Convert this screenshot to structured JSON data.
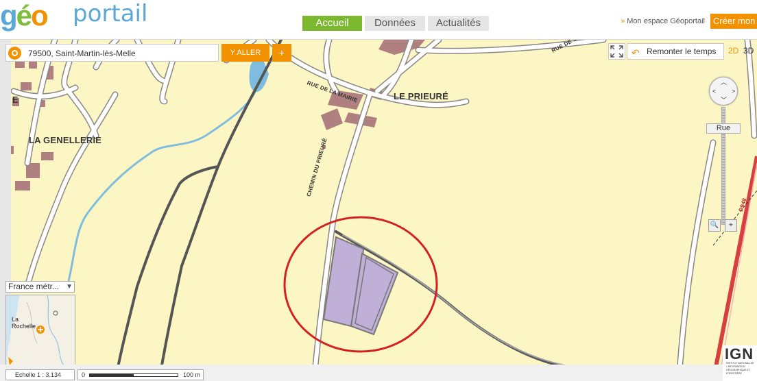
{
  "header": {
    "logo": {
      "geo": "géo",
      "portail": "portail"
    },
    "nav": [
      {
        "label": "Accueil",
        "active": true
      },
      {
        "label": "Données",
        "active": false
      },
      {
        "label": "Actualités",
        "active": false
      }
    ],
    "espace_label": "Mon espace Géoportail",
    "creer_label": "Créer mon"
  },
  "search": {
    "value": "79500, Saint-Martin-lès-Melle",
    "aller_label": "Y ALLER",
    "plus_label": "+"
  },
  "tools": {
    "remonter_label": "Remonter le temps",
    "mode_2d": "2D",
    "mode_3d": "3D"
  },
  "zoom": {
    "level_label": "Rue"
  },
  "map": {
    "places": {
      "prieure": "LE PRIEURÉ",
      "genellerie": "LA GENELLERIE",
      "edge_e": "E"
    },
    "roads": {
      "mairie": "RUE DE LA MAIRIE",
      "chemin": "CHEMIN DU PRIEURÉ",
      "rue_de": "RUE DE S",
      "d948": "D948"
    }
  },
  "minimap": {
    "projection": "France métr...",
    "city_line1": "La",
    "city_line2": "Rochelle"
  },
  "scale": {
    "echelle": "Echelle 1 :  3.134",
    "zero": "0",
    "end": "100 m"
  },
  "ign": {
    "logo": "IGN",
    "tagline": "Institut national de l'information géographique et forestière"
  },
  "colors": {
    "accent_orange": "#f39200",
    "nav_green": "#7cb82f",
    "map_bg": "#fbf6c3",
    "building": "#b08080",
    "parcel": "#c0b0d8",
    "circle": "#d42020"
  }
}
